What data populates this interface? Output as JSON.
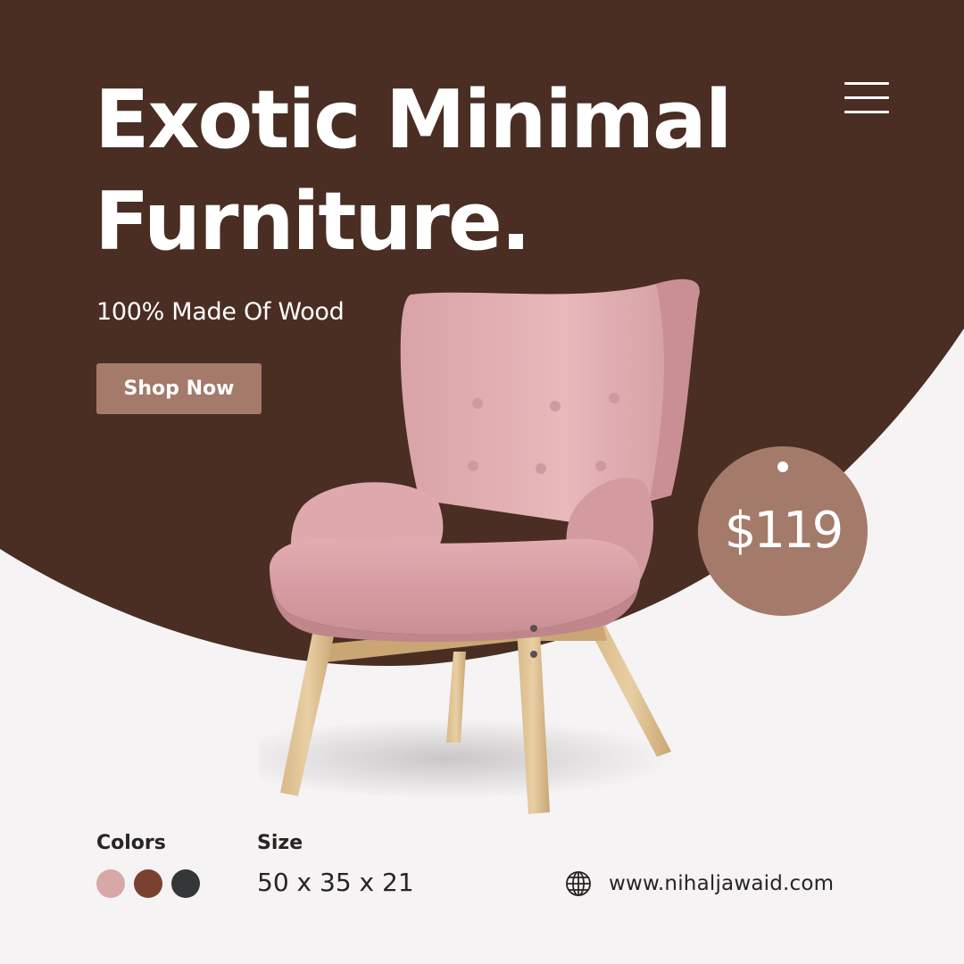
{
  "brand_colors": {
    "background_dark": "#4a2d23",
    "background_light": "#f5f3f4",
    "accent": "#a47a6a",
    "text_dark": "#2a2322",
    "text_light": "#ffffff"
  },
  "header": {
    "title_line1": "Exotic Minimal",
    "title_line2": "Furniture.",
    "subtitle": "100% Made Of Wood",
    "cta_label": "Shop Now",
    "menu_icon": "hamburger-menu-icon"
  },
  "product": {
    "image": "pink-armchair",
    "price": "$119"
  },
  "details": {
    "colors_label": "Colors",
    "colors": [
      {
        "name": "pink",
        "hex": "#d7a8a7"
      },
      {
        "name": "brown",
        "hex": "#7a4130"
      },
      {
        "name": "charcoal",
        "hex": "#343638"
      }
    ],
    "size_label": "Size",
    "size_value": "50 x 35 x 21"
  },
  "footer": {
    "website_icon": "globe-icon",
    "website": "www.nihaljawaid.com"
  }
}
